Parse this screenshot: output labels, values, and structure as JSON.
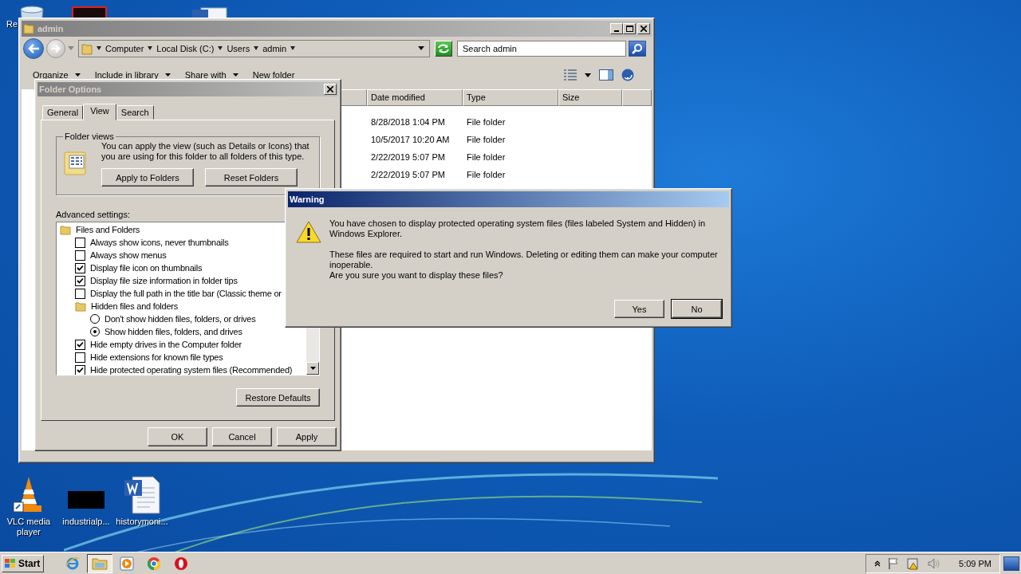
{
  "desktop_icons": [
    {
      "kind": "recycle",
      "label": "Re"
    },
    {
      "kind": "vlc",
      "label": "VLC media player"
    },
    {
      "kind": "black",
      "label": "industrialp..."
    },
    {
      "kind": "word",
      "label": "historymoni..."
    }
  ],
  "explorer": {
    "title": "admin",
    "breadcrumb": [
      "Computer",
      "Local Disk (C:)",
      "Users",
      "admin"
    ],
    "search": {
      "placeholder": "Search admin"
    },
    "toolbar": [
      "Organize",
      "Include in library",
      "Share with",
      "New folder"
    ],
    "columns": [
      "Date modified",
      "Type",
      "Size"
    ],
    "rows": [
      {
        "date_modified": "8/28/2018 1:04 PM",
        "type": "File folder"
      },
      {
        "date_modified": "10/5/2017 10:20 AM",
        "type": "File folder"
      },
      {
        "date_modified": "2/22/2019 5:07 PM",
        "type": "File folder"
      },
      {
        "date_modified": "2/22/2019 5:07 PM",
        "type": "File folder"
      }
    ]
  },
  "folder_options": {
    "title": "Folder Options",
    "tabs": [
      {
        "label": "General",
        "selected": false
      },
      {
        "label": "View",
        "selected": true
      },
      {
        "label": "Search",
        "selected": false
      }
    ],
    "folder_views": {
      "legend": "Folder views",
      "text": "You can apply the view (such as Details or Icons) that you are using for this folder to all folders of this type.",
      "buttons": [
        "Apply to Folders",
        "Reset Folders"
      ]
    },
    "advanced_label": "Advanced settings:",
    "settings": [
      {
        "kind": "group",
        "label": "Files and Folders",
        "children": [
          {
            "kind": "checkbox",
            "label": "Always show icons, never thumbnails",
            "checked": false
          },
          {
            "kind": "checkbox",
            "label": "Always show menus",
            "checked": false
          },
          {
            "kind": "checkbox",
            "label": "Display file icon on thumbnails",
            "checked": true
          },
          {
            "kind": "checkbox",
            "label": "Display file size information in folder tips",
            "checked": true
          },
          {
            "kind": "checkbox",
            "label": "Display the full path in the title bar (Classic theme or",
            "checked": false
          },
          {
            "kind": "group",
            "label": "Hidden files and folders",
            "children": [
              {
                "kind": "radio",
                "label": "Don't show hidden files, folders, or drives",
                "selected": false
              },
              {
                "kind": "radio",
                "label": "Show hidden files, folders, and drives",
                "selected": true
              }
            ]
          },
          {
            "kind": "checkbox",
            "label": "Hide empty drives in the Computer folder",
            "checked": true
          },
          {
            "kind": "checkbox",
            "label": "Hide extensions for known file types",
            "checked": false
          },
          {
            "kind": "checkbox",
            "label": "Hide protected operating system files (Recommended)",
            "checked": true
          }
        ]
      }
    ],
    "restore_button": "Restore Defaults",
    "buttons": [
      "OK",
      "Cancel",
      "Apply"
    ]
  },
  "warning": {
    "title": "Warning",
    "paragraphs": [
      "You have chosen to display protected operating system files (files labeled System and Hidden) in Windows Explorer.",
      "These files are required to start and run Windows. Deleting or editing them can make your computer inoperable.",
      "Are you sure you want to display these files?"
    ],
    "buttons": [
      "Yes",
      "No"
    ]
  },
  "taskbar": {
    "start": "Start",
    "apps": [
      {
        "kind": "ie",
        "selected": false
      },
      {
        "kind": "explorer",
        "selected": true
      },
      {
        "kind": "media",
        "selected": false
      },
      {
        "kind": "chrome",
        "selected": false
      },
      {
        "kind": "opera",
        "selected": false
      }
    ],
    "clock": "5:09 PM"
  }
}
